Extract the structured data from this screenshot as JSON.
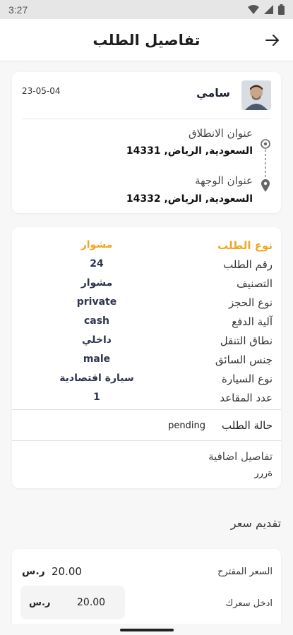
{
  "status_bar": {
    "time": "3:27",
    "icons": [
      "wifi-icon",
      "signal-icon",
      "battery-icon"
    ]
  },
  "app_bar": {
    "title": "تفاصيل الطلب",
    "back_icon": "arrow-right-icon"
  },
  "trip": {
    "username": "سامي",
    "date": "23-05-04",
    "pickup_label": "عنوان الانطلاق",
    "pickup_value": "السعودية, الرياض, 14331",
    "dropoff_label": "عنوان الوجهة",
    "dropoff_value": "السعودية, الرياض, 14332"
  },
  "details": {
    "rows": [
      {
        "label": "نوع الطلب",
        "value": "مشوار"
      },
      {
        "label": "رقم الطلب",
        "value": "24"
      },
      {
        "label": "التصنيف",
        "value": "مشوار"
      },
      {
        "label": "نوع الحجز",
        "value": "private"
      },
      {
        "label": "آلية الدفع",
        "value": "cash"
      },
      {
        "label": "نطاق التنقل",
        "value": "داخلي"
      },
      {
        "label": "جنس السائق",
        "value": "male"
      },
      {
        "label": "نوع السيارة",
        "value": "سيارة اقتصادية"
      },
      {
        "label": "عدد المقاعد",
        "value": "1"
      }
    ],
    "status_label": "حالة الطلب",
    "status_value": "pending",
    "extra_title": "تفاصيل اضافية",
    "extra_value": "ةررر"
  },
  "offer": {
    "section_title": "تقديم سعر",
    "suggested_label": "السعر المقترح",
    "suggested_value": "20.00",
    "currency": "ر.س",
    "input_label": "ادخل سعرك",
    "input_value": "20.00",
    "input_currency": "ر.س"
  },
  "colors": {
    "accent": "#f2a621",
    "value_text": "#2d3550"
  }
}
